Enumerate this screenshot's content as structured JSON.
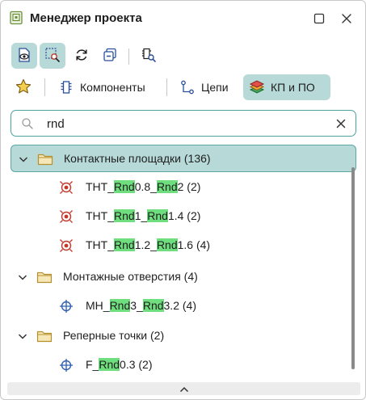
{
  "window": {
    "title": "Менеджер проекта"
  },
  "tabs": [
    {
      "label": "Компоненты",
      "active": false
    },
    {
      "label": "Цепи",
      "active": false
    },
    {
      "label": "КП и ПО",
      "active": true
    }
  ],
  "search": {
    "value": "rnd",
    "placeholder": ""
  },
  "tree": {
    "groups": [
      {
        "label": "Контактные площадки (136)",
        "expanded": true,
        "selected": true,
        "items": [
          {
            "parts": [
              "THT_",
              "Rnd",
              "0.8_",
              "Rnd",
              "2 (2)"
            ]
          },
          {
            "parts": [
              "THT_",
              "Rnd",
              "1_",
              "Rnd",
              "1.4 (2)"
            ]
          },
          {
            "parts": [
              "THT_",
              "Rnd",
              "1.2_",
              "Rnd",
              "1.6 (4)"
            ]
          }
        ]
      },
      {
        "label": "Монтажные отверстия (4)",
        "expanded": true,
        "selected": false,
        "items": [
          {
            "parts": [
              "MH_",
              "Rnd",
              "3_",
              "Rnd",
              "3.2 (4)"
            ]
          }
        ]
      },
      {
        "label": "Реперные точки (2)",
        "expanded": true,
        "selected": false,
        "items": [
          {
            "parts": [
              "F_",
              "Rnd",
              "0.3 (2)"
            ]
          }
        ]
      }
    ]
  },
  "colors": {
    "accent": "#b7dad8",
    "accent_border": "#4ba3a0",
    "highlight": "#6fde7e",
    "pad_icon": "#c0392b",
    "hole_icon": "#2f5fb0",
    "folder": "#c8a23c"
  }
}
